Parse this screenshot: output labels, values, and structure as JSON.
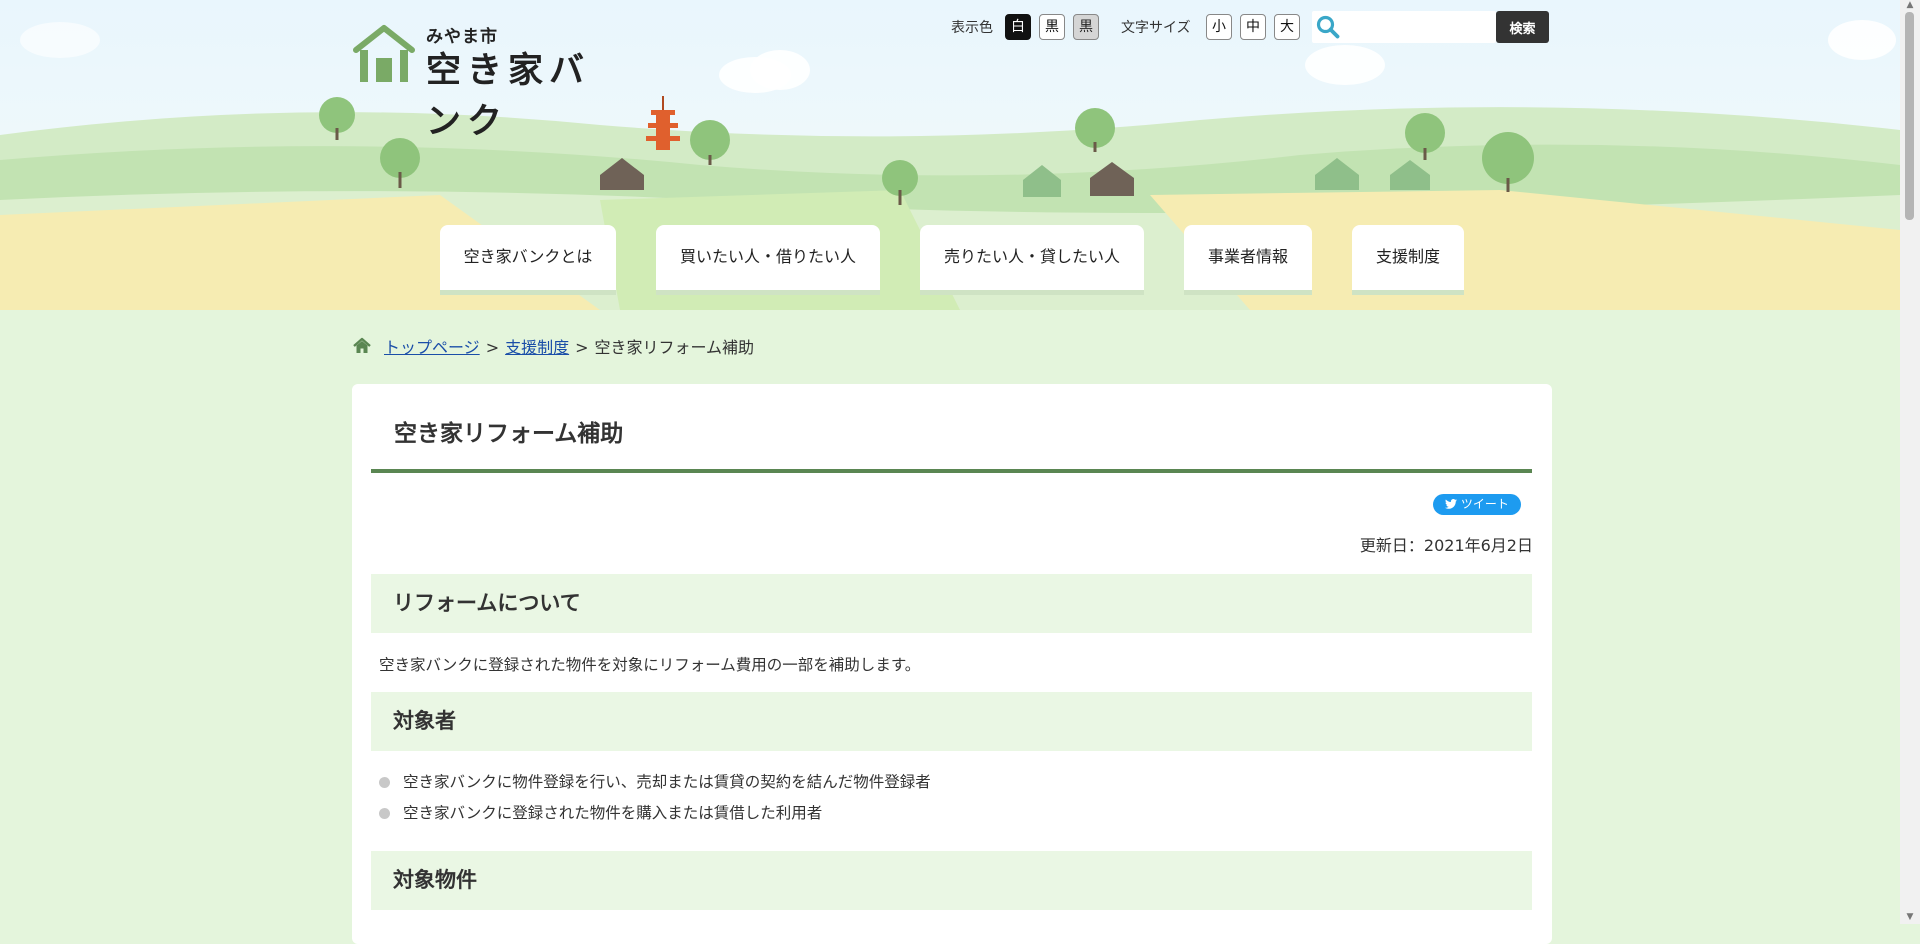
{
  "header": {
    "logo_sub": "みやま市",
    "logo_main": "空き家バンク",
    "display_color_label": "表示色",
    "color_buttons": [
      "白",
      "黒",
      "黒"
    ],
    "font_size_label": "文字サイズ",
    "font_buttons": [
      "小",
      "中",
      "大"
    ],
    "search_placeholder": "",
    "search_button": "検索"
  },
  "nav": {
    "tabs": [
      {
        "label": "空き家バンクとは"
      },
      {
        "label": "買いたい人・借りたい人"
      },
      {
        "label": "売りたい人・貸したい人"
      },
      {
        "label": "事業者情報"
      },
      {
        "label": "支援制度"
      }
    ]
  },
  "breadcrumb": {
    "home": "トップページ",
    "separator": ">",
    "parent": "支援制度",
    "current": "空き家リフォーム補助"
  },
  "main": {
    "title": "空き家リフォーム補助",
    "tweet": "ツイート",
    "updated": "更新日：2021年6月2日",
    "sections": [
      {
        "heading": "リフォームについて",
        "text": "空き家バンクに登録された物件を対象にリフォーム費用の一部を補助します。"
      },
      {
        "heading": "対象者",
        "items": [
          "空き家バンクに物件登録を行い、売却または賃貸の契約を結んだ物件登録者",
          "空き家バンクに登録された物件を購入または賃借した利用者"
        ]
      },
      {
        "heading": "対象物件"
      }
    ]
  },
  "colors": {
    "page_bg": "#e4f5dc",
    "title_rule": "#5a8652",
    "section_bg": "#eaf7e4",
    "link": "#1a4ea8",
    "tweet": "#1d9bf0"
  }
}
